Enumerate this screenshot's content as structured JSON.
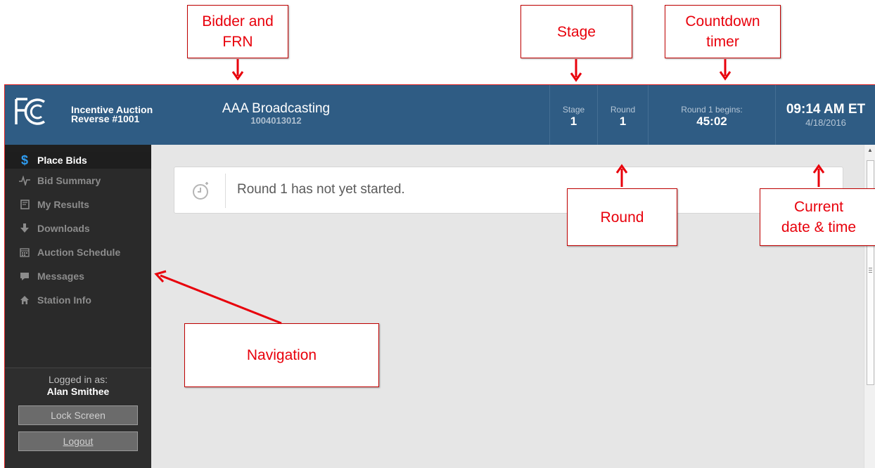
{
  "header": {
    "app_title_line1": "Incentive Auction",
    "app_title_line2": "Reverse #1001",
    "bidder_name": "AAA Broadcasting",
    "frn": "1004013012",
    "stage_label": "Stage",
    "stage_value": "1",
    "round_label": "Round",
    "round_value": "1",
    "timer_label": "Round 1 begins:",
    "timer_value": "45:02",
    "time": "09:14 AM ET",
    "date": "4/18/2016",
    "bg_color": "#2f5c84"
  },
  "sidebar": {
    "items": [
      {
        "label": "Place Bids",
        "icon": "dollar-icon",
        "active": true
      },
      {
        "label": "Bid Summary",
        "icon": "pulse-icon",
        "active": false
      },
      {
        "label": "My Results",
        "icon": "results-icon",
        "active": false
      },
      {
        "label": "Downloads",
        "icon": "download-arrow-icon",
        "active": false
      },
      {
        "label": "Auction Schedule",
        "icon": "calendar-icon",
        "active": false
      },
      {
        "label": "Messages",
        "icon": "chat-bubble-icon",
        "active": false
      },
      {
        "label": "Station Info",
        "icon": "home-icon",
        "active": false
      }
    ],
    "logged_in_label": "Logged in as:",
    "user_name": "Alan Smithee",
    "lock_label": "Lock Screen",
    "logout_label": "Logout"
  },
  "main": {
    "notice": "Round 1 has not yet started.",
    "notice_icon": "clock-icon"
  },
  "annotations": {
    "bidder_line1": "Bidder and",
    "bidder_line2": "FRN",
    "stage": "Stage",
    "timer_line1": "Countdown",
    "timer_line2": "timer",
    "round": "Round",
    "current_line1": "Current",
    "current_line2": "date & time",
    "navigation": "Navigation",
    "color": "#e8000b"
  }
}
